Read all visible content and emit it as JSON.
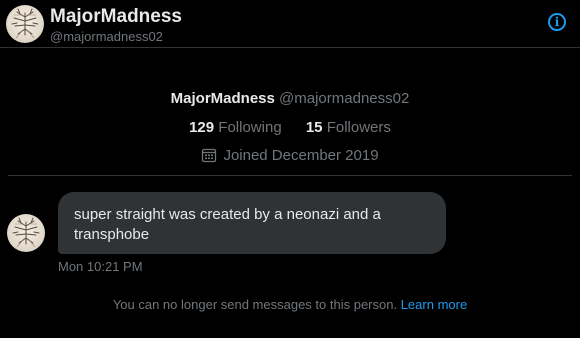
{
  "header": {
    "name": "MajorMadness",
    "handle": "@majormadness02",
    "info_icon": "info-icon"
  },
  "profile": {
    "name": "MajorMadness",
    "handle": "@majormadness02",
    "following_count": "129",
    "following_label": "Following",
    "followers_count": "15",
    "followers_label": "Followers",
    "joined": "Joined December 2019",
    "calendar_icon": "calendar-icon"
  },
  "message": {
    "text": "super straight was created by a neonazi and a transphobe",
    "time": "Mon 10:21 PM"
  },
  "notice": {
    "text": "You can no longer send messages to this person.",
    "link": "Learn more"
  },
  "colors": {
    "background": "#000000",
    "accent": "#1d9bf0",
    "bubble": "#2f3336",
    "secondary_text": "#71767b"
  }
}
